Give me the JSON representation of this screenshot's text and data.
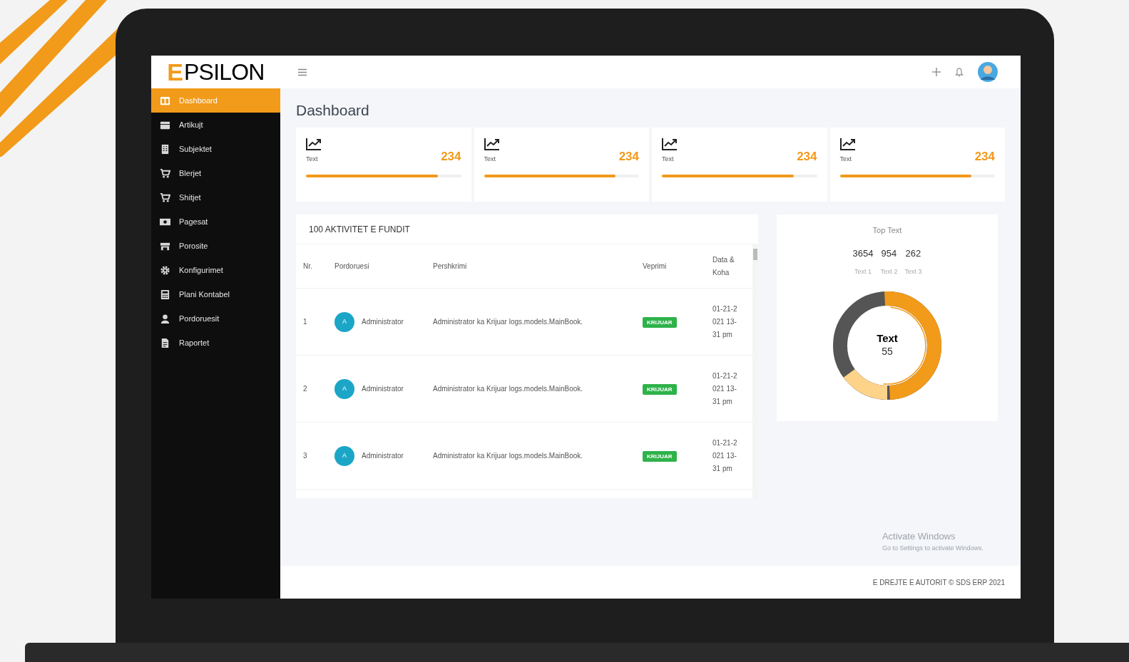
{
  "logo": {
    "mark": "E",
    "text": "PSILON"
  },
  "sidebar": {
    "items": [
      {
        "label": "Dashboard",
        "selected": true
      },
      {
        "label": "Artikujt",
        "selected": false
      },
      {
        "label": "Subjektet",
        "selected": false
      },
      {
        "label": "Blerjet",
        "selected": false
      },
      {
        "label": "Shitjet",
        "selected": false
      },
      {
        "label": "Pagesat",
        "selected": false
      },
      {
        "label": "Porosite",
        "selected": false
      },
      {
        "label": "Konfigurimet",
        "selected": false
      },
      {
        "label": "Plani Kontabel",
        "selected": false
      },
      {
        "label": "Pordoruesit",
        "selected": false
      },
      {
        "label": "Raportet",
        "selected": false
      }
    ]
  },
  "page_title": "Dashboard",
  "stat_cards": [
    {
      "label": "Text",
      "value": "234",
      "level": 0.85
    },
    {
      "label": "Text",
      "value": "234",
      "level": 0.85
    },
    {
      "label": "Text",
      "value": "234",
      "level": 0.85
    },
    {
      "label": "Text",
      "value": "234",
      "level": 0.85
    }
  ],
  "activity": {
    "title": "100 AKTIVITET E FUNDIT",
    "columns": [
      "Nr.",
      "Pordoruesi",
      "Pershkrimi",
      "Veprimi",
      "Data & Koha"
    ],
    "rows": [
      {
        "nr": "1",
        "avatar": "A",
        "user": "Administrator",
        "description": "Administrator ka Krijuar logs.models.MainBook.",
        "action": "KRIJUAR",
        "datetime": "01-21-2021 13-31 pm"
      },
      {
        "nr": "2",
        "avatar": "A",
        "user": "Administrator",
        "description": "Administrator ka Krijuar logs.models.MainBook.",
        "action": "KRIJUAR",
        "datetime": "01-21-2021 13-31 pm"
      },
      {
        "nr": "3",
        "avatar": "A",
        "user": "Administrator",
        "description": "Administrator ka Krijuar logs.models.MainBook.",
        "action": "KRIJUAR",
        "datetime": "01-21-2021 13-31 pm"
      }
    ]
  },
  "top_panel": {
    "title": "Top Text",
    "stats": [
      {
        "value": "3654",
        "label": "Text 1"
      },
      {
        "value": "954",
        "label": "Text 2"
      },
      {
        "value": "262",
        "label": "Text 3"
      }
    ],
    "center_label": "Text",
    "center_value": "55"
  },
  "activation_notice": {
    "title": "Activate Windows",
    "subtitle": "Go to Settings to activate Windows."
  },
  "footer": "E DREJTE E AUTORIT © SDS ERP 2021"
}
